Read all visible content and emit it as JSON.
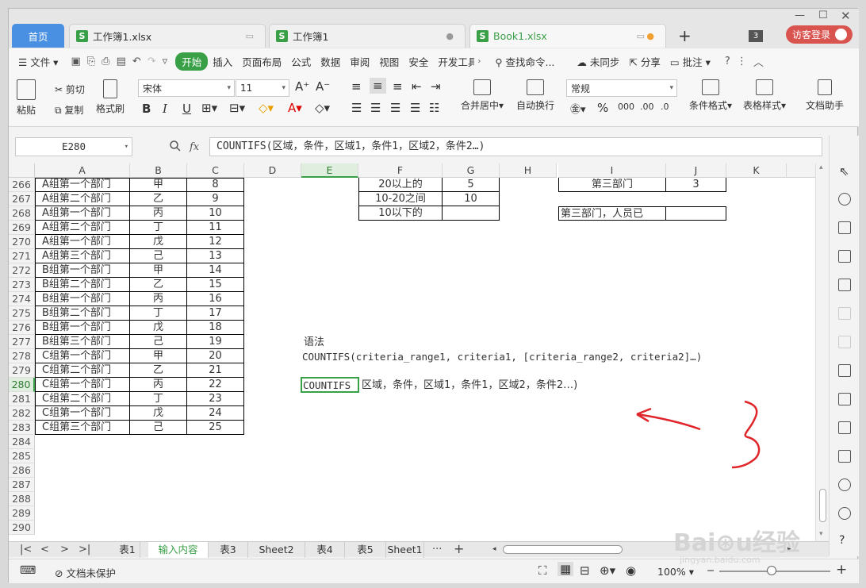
{
  "tabs": {
    "home": "首页",
    "t1": "工作簿1.xlsx",
    "t2": "工作簿1",
    "t3": "Book1.xlsx",
    "win_count": "3",
    "login": "访客登录"
  },
  "menu": {
    "file": "文件",
    "items": [
      "开始",
      "插入",
      "页面布局",
      "公式",
      "数据",
      "审阅",
      "视图",
      "安全",
      "开发工具"
    ],
    "search": "查找命令...",
    "unsync": "未同步",
    "share": "分享",
    "comment": "批注"
  },
  "ribbon": {
    "paste": "粘贴",
    "cut": "剪切",
    "copy": "复制",
    "format_painter": "格式刷",
    "font_name": "宋体",
    "font_size": "11",
    "merge": "合并居中",
    "wrap": "自动换行",
    "number_format": "常规",
    "cond_format": "条件格式",
    "table_style": "表格样式",
    "doc_helper": "文档助手"
  },
  "formula_bar": {
    "cell_ref": "E280",
    "fx": "fx",
    "formula": "COUNTIFS(区域，条件，区域1，条件1，区域2，条件2…)"
  },
  "columns": [
    "A",
    "B",
    "C",
    "D",
    "E",
    "F",
    "G",
    "H",
    "I",
    "J",
    "K"
  ],
  "rows": [
    {
      "n": "266",
      "a": "A组第一个部门",
      "b": "甲",
      "c": "8"
    },
    {
      "n": "267",
      "a": "A组第二个部门",
      "b": "乙",
      "c": "9"
    },
    {
      "n": "268",
      "a": "A组第一个部门",
      "b": "丙",
      "c": "10"
    },
    {
      "n": "269",
      "a": "A组第二个部门",
      "b": "丁",
      "c": "11"
    },
    {
      "n": "270",
      "a": "A组第一个部门",
      "b": "戊",
      "c": "12"
    },
    {
      "n": "271",
      "a": "A组第三个部门",
      "b": "己",
      "c": "13"
    },
    {
      "n": "272",
      "a": "B组第一个部门",
      "b": "甲",
      "c": "14"
    },
    {
      "n": "273",
      "a": "B组第二个部门",
      "b": "乙",
      "c": "15"
    },
    {
      "n": "274",
      "a": "B组第一个部门",
      "b": "丙",
      "c": "16"
    },
    {
      "n": "275",
      "a": "B组第二个部门",
      "b": "丁",
      "c": "17"
    },
    {
      "n": "276",
      "a": "B组第一个部门",
      "b": "戊",
      "c": "18"
    },
    {
      "n": "277",
      "a": "B组第三个部门",
      "b": "己",
      "c": "19"
    },
    {
      "n": "278",
      "a": "C组第一个部门",
      "b": "甲",
      "c": "20"
    },
    {
      "n": "279",
      "a": "C组第二个部门",
      "b": "乙",
      "c": "21"
    },
    {
      "n": "280",
      "a": "C组第一个部门",
      "b": "丙",
      "c": "22"
    },
    {
      "n": "281",
      "a": "C组第二个部门",
      "b": "丁",
      "c": "23"
    },
    {
      "n": "282",
      "a": "C组第一个部门",
      "b": "戊",
      "c": "24"
    },
    {
      "n": "283",
      "a": "C组第三个部门",
      "b": "己",
      "c": "25"
    },
    {
      "n": "284"
    },
    {
      "n": "285"
    },
    {
      "n": "286"
    },
    {
      "n": "287"
    },
    {
      "n": "288"
    },
    {
      "n": "289"
    },
    {
      "n": "290"
    }
  ],
  "side_table": {
    "f266": "20以上的",
    "g266": "5",
    "f267": "10-20之间",
    "g267": "10",
    "f268": "10以下的",
    "g268": "",
    "i266": "第三部门",
    "j266": "3",
    "i268": "第三部门，人员已",
    "j268": ""
  },
  "syntax": {
    "label": "语法",
    "line": "COUNTIFS(criteria_range1, criteria1, [criteria_range2, criteria2]…)",
    "e280": "COUNTIFS",
    "rest": "区域，条件，区域1，条件1，区域2，条件2…)"
  },
  "sheets": [
    "表1",
    "输入内容",
    "表3",
    "Sheet2",
    "表4",
    "表5",
    "Sheet1"
  ],
  "active_sheet": "输入内容",
  "status": {
    "protect": "文档未保护",
    "zoom": "100%"
  },
  "annotation_color": "#e0262a",
  "accent": "#3aa047"
}
